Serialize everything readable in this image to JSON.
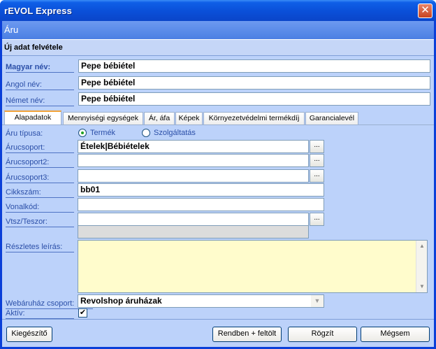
{
  "window": {
    "title": "rEVOL Express",
    "close": "✕"
  },
  "header": {
    "title": "Áru",
    "subtitle": "Új adat felvétele"
  },
  "names": {
    "hu_label": "Magyar név:",
    "hu_value": "Pepe bébiétel",
    "en_label": "Angol név:",
    "en_value": "Pepe bébiétel",
    "de_label": "Német név:",
    "de_value": "Pepe bébiétel"
  },
  "tabs": [
    "Alapadatok",
    "Mennyiségi egységek",
    "Ár, áfa",
    "Képek",
    "Környezetvédelmi termékdíj",
    "Garancialevél"
  ],
  "form": {
    "type_label": "Áru típusa:",
    "type_option_product": "Termék",
    "type_option_service": "Szolgáltatás",
    "group1_label": "Árucsoport:",
    "group1_value": "Ételek|Bébiételek",
    "group2_label": "Árucsoport2:",
    "group2_value": "",
    "group3_label": "Árucsoport3:",
    "group3_value": "",
    "sku_label": "Cikkszám:",
    "sku_value": "bb01",
    "barcode_label": "Vonalkód:",
    "barcode_value": "",
    "vtsz_label": "Vtsz/Teszor:",
    "vtsz_value": "",
    "desc_label": "Részletes leírás:",
    "webshop_label": "Webáruház csoport:",
    "webshop_value": "Revolshop áruházak",
    "active_label": "Aktív:",
    "active_check": "✔",
    "dots": "..."
  },
  "buttons": {
    "extra": "Kiegészítő",
    "ok_upload": "Rendben + feltölt",
    "save": "Rögzít",
    "cancel": "Mégsem"
  },
  "icons": {
    "scroll_up": "▲",
    "scroll_down": "▼",
    "combo_arrow": "▼"
  }
}
